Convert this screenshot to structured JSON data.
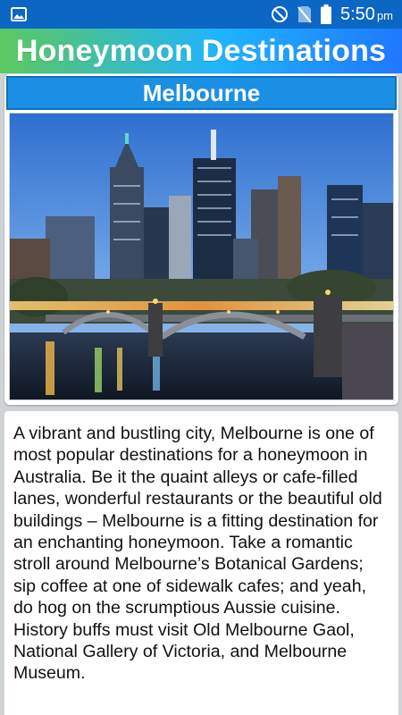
{
  "status_bar": {
    "time": "5:50",
    "ampm": "pm",
    "icons": [
      "image-icon",
      "do-not-disturb-icon",
      "no-sim-icon",
      "battery-icon"
    ]
  },
  "header": {
    "title": "Honeymoon Destinations"
  },
  "destination": {
    "name": "Melbourne",
    "image_subject": "Melbourne skyline at dusk with bridge over river",
    "description": "A vibrant and bustling city, Melbourne is one of most popular destinations for a honeymoon in Australia. Be it the quaint alleys or cafe-filled lanes, wonderful restaurants or the beautiful old buildings – Melbourne is a fitting destination for an enchanting honeymoon. Take a romantic stroll around Melbourne’s Botanical Gardens; sip coffee at one of sidewalk cafes; and yeah, do hog on the scrumptious Aussie cuisine. History buffs must visit Old Melbourne Gaol, National Gallery of Victoria, and Melbourne Museum."
  },
  "colors": {
    "status_bar": "#0b66c4",
    "title_bar": "#1b8fe3",
    "gradient_start": "#5cc85f",
    "gradient_end": "#1f77ff"
  }
}
